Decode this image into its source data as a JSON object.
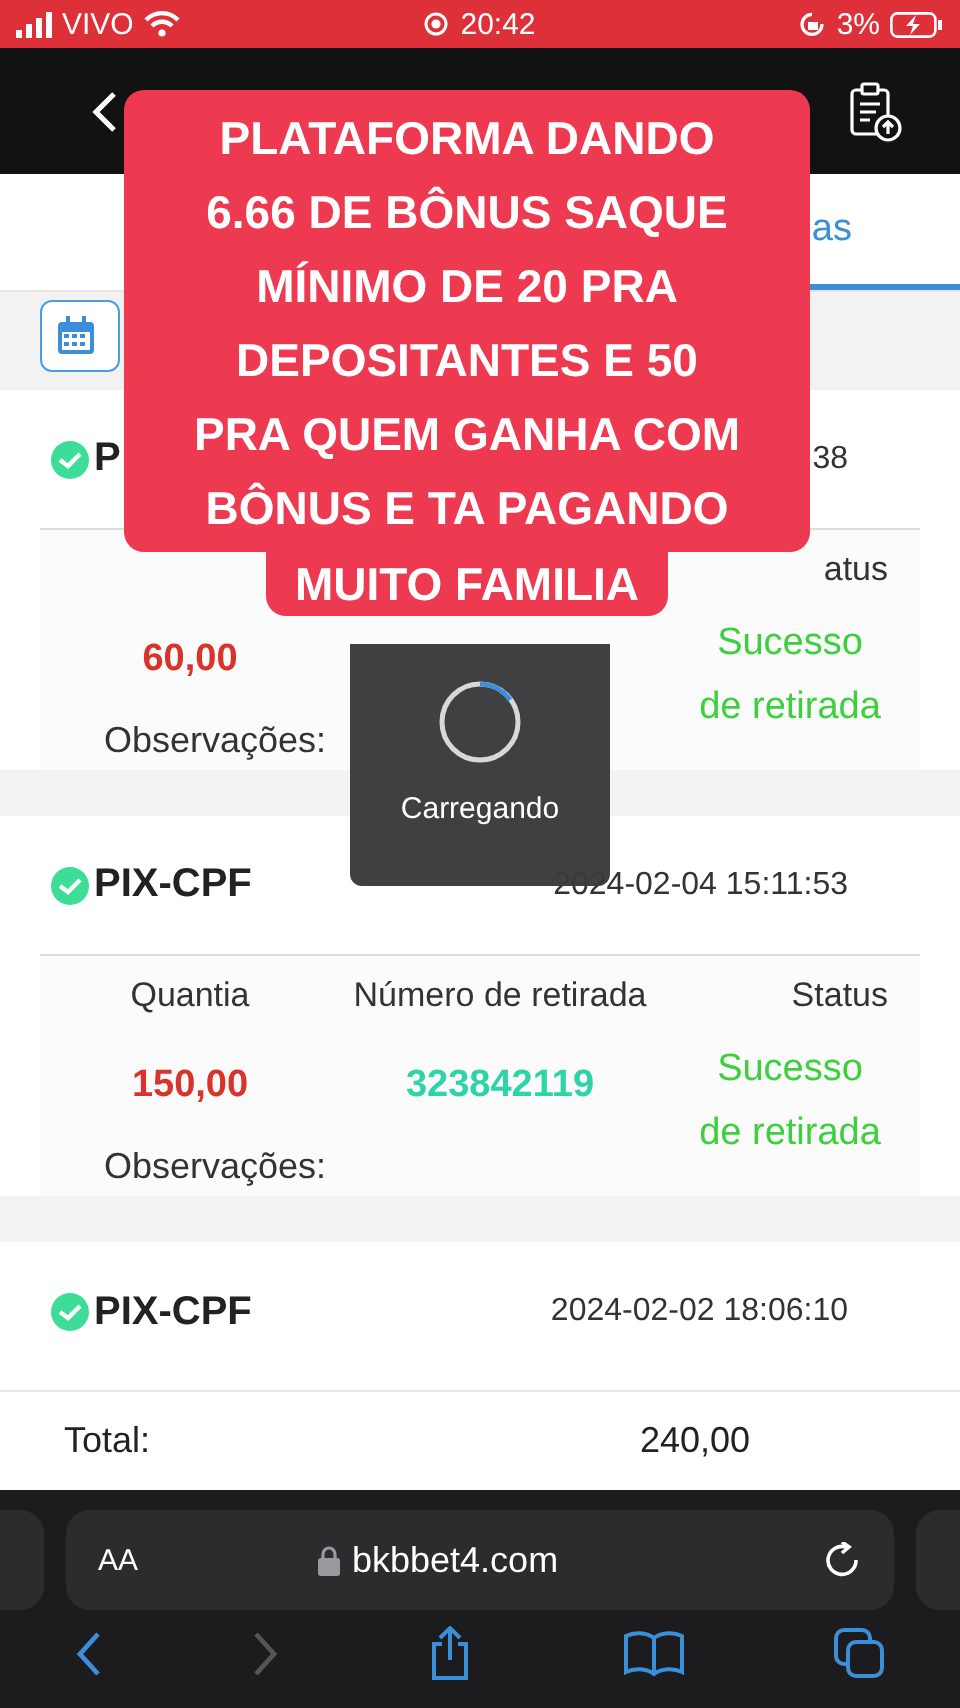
{
  "status_bar": {
    "carrier": "VIVO",
    "time": "20:42",
    "battery": "3%"
  },
  "caption": {
    "lines": [
      "PLATAFORMA DANDO",
      "6.66 DE BÔNUS SAQUE",
      "MÍNIMO DE 20 PRA",
      "DEPOSITANTES E 50",
      "PRA QUEM GANHA COM",
      "BÔNUS E TA PAGANDO"
    ],
    "tail": "MUITO FAMILIA"
  },
  "tabs": [
    {
      "label": "as",
      "selected": true
    }
  ],
  "records": [
    {
      "method": "P",
      "time": "38",
      "status_header": "atus",
      "amount": "60,00",
      "status": "Sucesso de retirada",
      "remark_label": "Observações:"
    },
    {
      "method": "PIX-CPF",
      "time": "2024-02-04 15:11:53",
      "headers": [
        "Quantia",
        "Número de retirada",
        "Status"
      ],
      "amount": "150,00",
      "number": "323842119",
      "status": "Sucesso de retirada",
      "remark_label": "Observações:"
    },
    {
      "method": "PIX-CPF",
      "time": "2024-02-02 18:06:10"
    }
  ],
  "loading": {
    "label": "Carregando"
  },
  "total": {
    "label": "Total:",
    "value": "240,00"
  },
  "browser": {
    "text_size": "AA",
    "url": "bkbbet4.com"
  }
}
